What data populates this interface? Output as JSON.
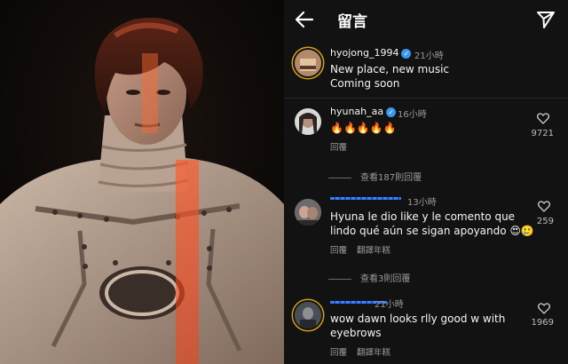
{
  "header": {
    "title": "留言"
  },
  "post": {
    "username": "hyojong_1994",
    "time": "21小時",
    "caption_line1": "New place, new music",
    "caption_line2": "Coming soon"
  },
  "comments": [
    {
      "username": "hyunah_aa",
      "time": "16小時",
      "text": "🔥🔥🔥🔥🔥",
      "likes": "9721",
      "reply_label": "回覆",
      "view_replies": "查看187則回覆"
    },
    {
      "username": "",
      "time": "13小時",
      "text_line1": "Hyuna le dio like y le comento que",
      "text_line2": "lindo qué aún se sigan apoyando 😍🥲",
      "likes": "259",
      "reply_label": "回覆",
      "translate_label": "翻譯年糕",
      "view_replies": "查看3則回覆"
    },
    {
      "username": "",
      "time": "21小時",
      "text_line1": "wow dawn looks rlly good w with",
      "text_line2": "eyebrows",
      "likes": "1969",
      "reply_label": "回覆",
      "translate_label": "翻譯年糕"
    }
  ],
  "colors": {
    "panel_bg": "#121212",
    "verified": "#3897f0",
    "muted_text": "#9a9a9a",
    "story_ring": "#d4a017"
  }
}
